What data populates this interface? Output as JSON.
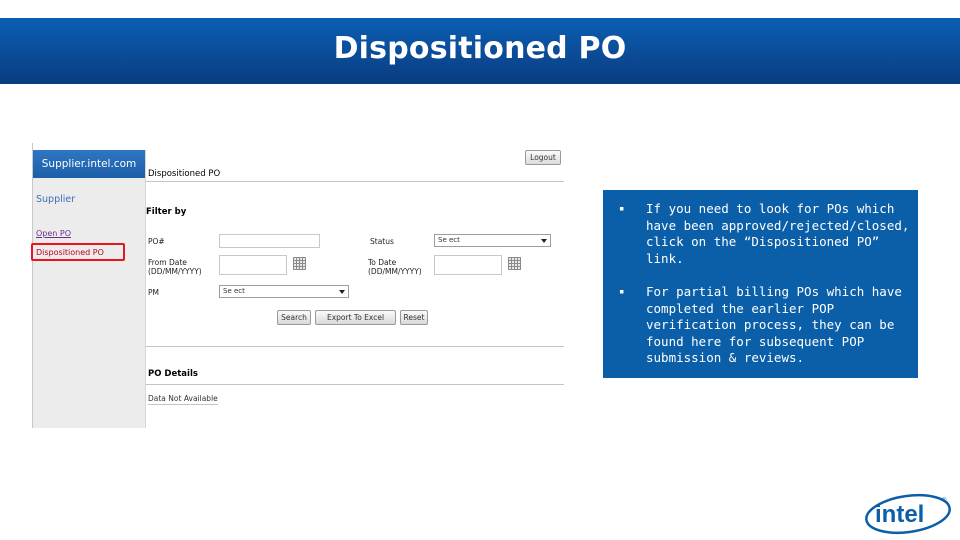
{
  "slide": {
    "title": "Dispositioned PO"
  },
  "portal": {
    "brand": "Supplier.intel.com",
    "logout_label": "Logout",
    "sidebar": {
      "heading": "Supplier",
      "items": [
        {
          "label": "Open PO",
          "active": false
        },
        {
          "label": "Dispositioned PO",
          "active": true
        }
      ]
    },
    "page_title": "Dispositioned PO",
    "filter": {
      "heading": "Filter by",
      "po_label": "PO#",
      "status_label": "Status",
      "status_value": "Se ect",
      "from_date_label_1": "From Date",
      "from_date_label_2": "(DD/MM/YYYY)",
      "to_date_label_1": "To Date",
      "to_date_label_2": "(DD/MM/YYYY)",
      "pm_label": "PM",
      "pm_value": "Se ect"
    },
    "buttons": {
      "search": "Search",
      "export": "Export To Excel",
      "reset": "Reset"
    },
    "details": {
      "heading": "PO Details",
      "empty_message": "Data Not Available"
    }
  },
  "info_box": {
    "bullet_glyph": "▪",
    "bullets": [
      "If you need to look for POs which have been approved/rejected/closed, click on the “Dispositioned PO” link.",
      "For partial billing POs which have completed the earlier POP verification process, they can be found here for subsequent POP submission & reviews."
    ]
  },
  "logo": {
    "text": "intel",
    "mark": "®",
    "color": "#0b5fa8"
  },
  "colors": {
    "title_bar": "#0b4f9c",
    "info_box": "#0b5fa8",
    "highlight": "#e8141f"
  }
}
